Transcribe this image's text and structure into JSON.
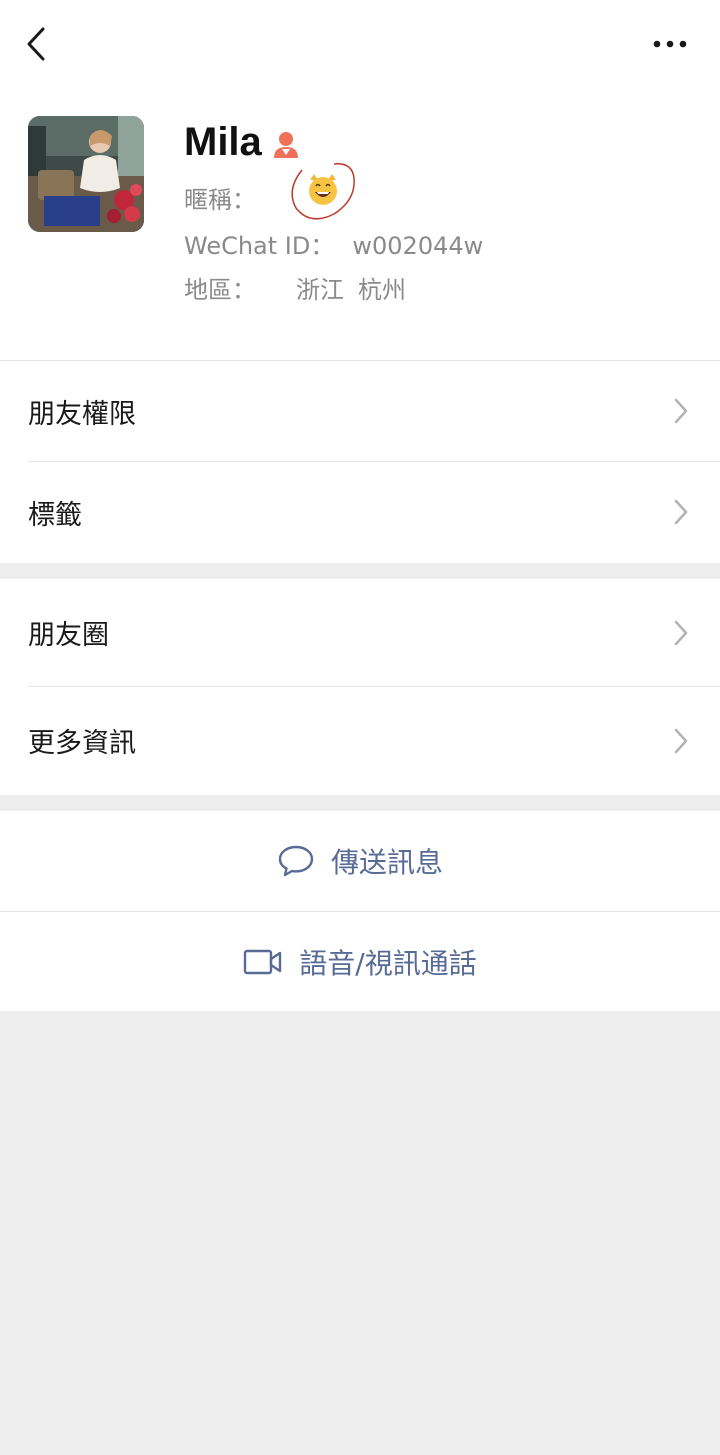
{
  "header": {
    "back_icon": "chevron-left-icon",
    "more_icon": "more-dots-icon"
  },
  "profile": {
    "name": "Mila",
    "gender_icon": "female-icon",
    "gender_color": "#f0715a",
    "nickname_label": "暱稱：",
    "nickname_emoji": "😸",
    "wechat_id_label": "WeChat ID：",
    "wechat_id": "w002044w",
    "region_label": "地區：",
    "region_province": "浙江",
    "region_city": "杭州"
  },
  "menu": {
    "items": [
      {
        "label": "朋友權限"
      },
      {
        "label": "標籤"
      },
      {
        "label": "朋友圈"
      },
      {
        "label": "更多資訊"
      }
    ]
  },
  "actions": {
    "send_message": "傳送訊息",
    "voice_video_call": "語音/視訊通話",
    "accent_color": "#576b95"
  }
}
